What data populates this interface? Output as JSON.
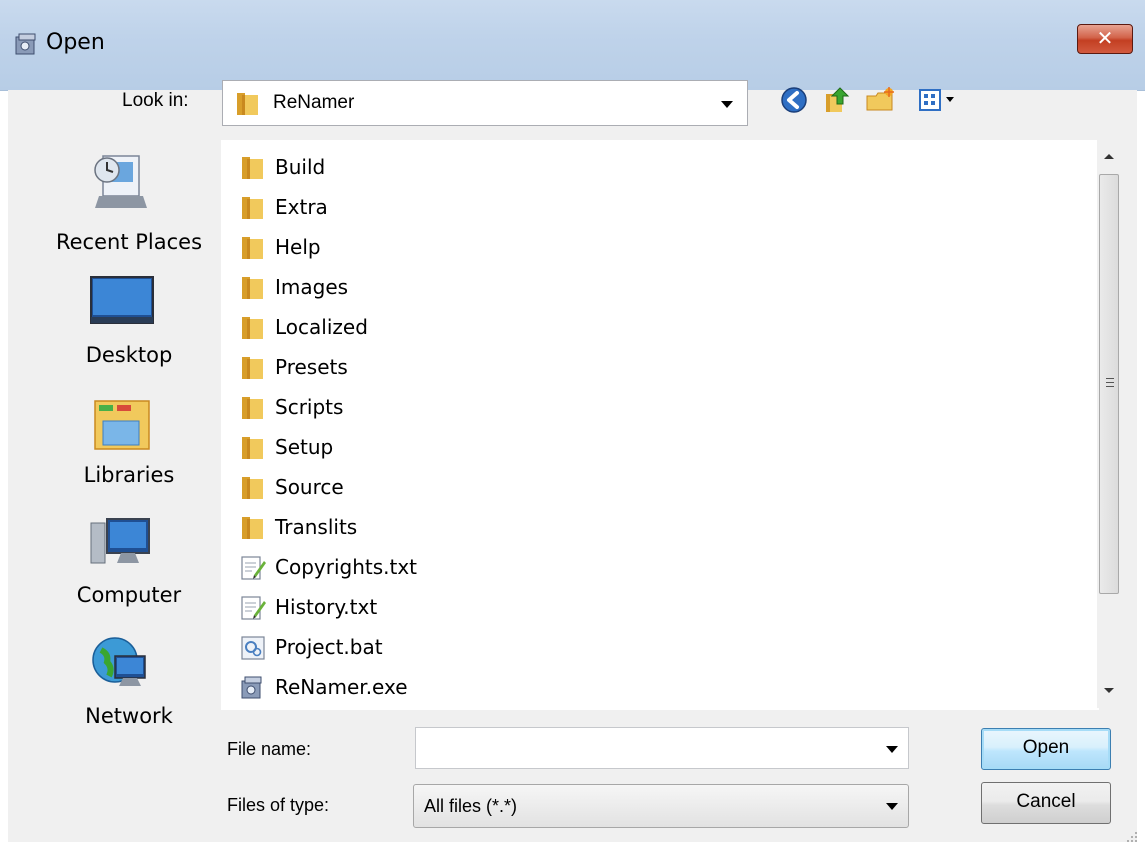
{
  "window": {
    "title": "Open",
    "close_label": "✕"
  },
  "toolbar": {
    "lookin_label": "Look in:",
    "lookin_value": "ReNamer",
    "icons": [
      "back-icon",
      "up-folder-icon",
      "new-folder-icon",
      "view-menu-icon"
    ]
  },
  "places": [
    {
      "label": "Recent Places",
      "icon": "recent-places-icon"
    },
    {
      "label": "Desktop",
      "icon": "desktop-icon"
    },
    {
      "label": "Libraries",
      "icon": "libraries-icon"
    },
    {
      "label": "Computer",
      "icon": "computer-icon"
    },
    {
      "label": "Network",
      "icon": "network-icon"
    }
  ],
  "files": [
    {
      "name": "Build",
      "type": "folder"
    },
    {
      "name": "Extra",
      "type": "folder"
    },
    {
      "name": "Help",
      "type": "folder"
    },
    {
      "name": "Images",
      "type": "folder"
    },
    {
      "name": "Localized",
      "type": "folder"
    },
    {
      "name": "Presets",
      "type": "folder"
    },
    {
      "name": "Scripts",
      "type": "folder"
    },
    {
      "name": "Setup",
      "type": "folder"
    },
    {
      "name": "Source",
      "type": "folder"
    },
    {
      "name": "Translits",
      "type": "folder"
    },
    {
      "name": "Copyrights.txt",
      "type": "text"
    },
    {
      "name": "History.txt",
      "type": "text"
    },
    {
      "name": "Project.bat",
      "type": "batch"
    },
    {
      "name": "ReNamer.exe",
      "type": "exe"
    }
  ],
  "bottom": {
    "filename_label": "File name:",
    "filename_value": "",
    "filetype_label": "Files of type:",
    "filetype_value": "All files (*.*)",
    "open_label": "Open",
    "cancel_label": "Cancel"
  },
  "colors": {
    "titlebar": "#bfd3ea",
    "close_button": "#c33f22",
    "folder": "#e8b84a",
    "open_button_border": "#3c7fb1"
  }
}
